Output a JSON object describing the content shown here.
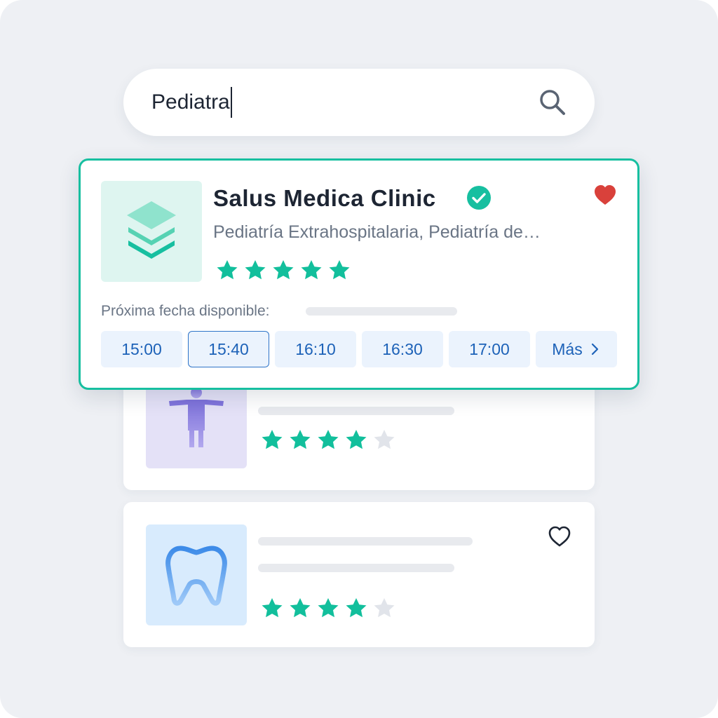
{
  "search": {
    "query": "Pediatra"
  },
  "featured": {
    "name": "Salus Medica Clinic",
    "specialty": "Pediatría Extrahospitalaria, Pediatría de…",
    "rating": 5,
    "favorited": true,
    "next_available_label": "Próxima fecha disponible:",
    "slots": [
      "15:00",
      "15:40",
      "16:10",
      "16:30",
      "17:00"
    ],
    "selected_slot": "15:40",
    "more_label": "Más"
  },
  "results": [
    {
      "icon": "accessibility-person-icon",
      "rating": 4
    },
    {
      "icon": "tooth-icon",
      "rating": 4,
      "favorited": false
    }
  ],
  "colors": {
    "accent": "#17bfa0",
    "star_filled": "#12bf9c",
    "star_empty": "#e1e4ea",
    "heart": "#d9413b",
    "slot_text": "#1d62b8",
    "slot_bg": "#ebf3fd"
  }
}
